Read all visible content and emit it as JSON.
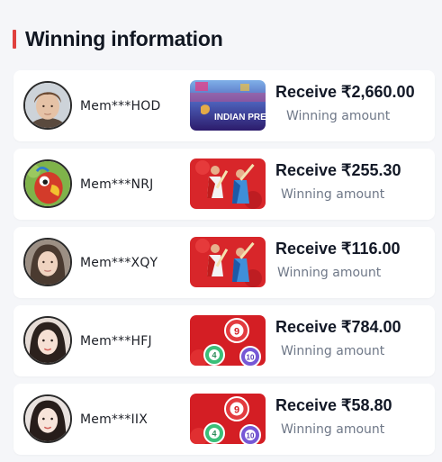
{
  "section": {
    "title": "Winning information"
  },
  "colors": {
    "accent": "#e0403e",
    "card_bg": "#ffffff",
    "page_bg": "#f5f6f9",
    "amount_text": "#121826",
    "label_text": "#6f7888"
  },
  "winners": [
    {
      "user": "Mem***HOD",
      "avatar": "young-man-avatar",
      "game": "indian-premier-league-thumbnail",
      "game_text": "INDIAN PREMIER",
      "amount": "Receive ₹2,660.00",
      "label": "Winning amount"
    },
    {
      "user": "Mem***NRJ",
      "avatar": "cartoon-parrot-avatar",
      "game": "cricket-game-thumbnail",
      "amount": "Receive ₹255.30",
      "label": "Winning amount"
    },
    {
      "user": "Mem***XQY",
      "avatar": "woman-avatar",
      "game": "cricket-game-thumbnail",
      "amount": "Receive ₹116.00",
      "label": "Winning amount"
    },
    {
      "user": "Mem***HFJ",
      "avatar": "woman-avatar",
      "game": "lottery-balls-thumbnail",
      "amount": "Receive ₹784.00",
      "label": "Winning amount"
    },
    {
      "user": "Mem***IIX",
      "avatar": "woman-avatar",
      "game": "lottery-balls-thumbnail",
      "amount": "Receive ₹58.80",
      "label": "Winning amount"
    }
  ],
  "lottery_balls": {
    "top": "9",
    "left": "4",
    "right": "10"
  }
}
